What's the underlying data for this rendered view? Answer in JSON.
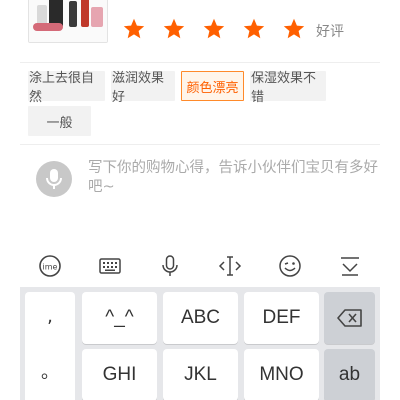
{
  "rating": {
    "stars": 5,
    "max_stars": 5,
    "label": "好评",
    "star_color": "#ff6000"
  },
  "tags": [
    {
      "label": "涂上去很自然",
      "selected": false
    },
    {
      "label": "滋润效果好",
      "selected": false
    },
    {
      "label": "颜色漂亮",
      "selected": true
    },
    {
      "label": "保湿效果不错",
      "selected": false
    },
    {
      "label": "一般",
      "selected": false
    }
  ],
  "comment": {
    "placeholder": "写下你的购物心得，告诉小伙伴们宝贝有多好吧~",
    "voice_icon": "mic-icon"
  },
  "toolbar": {
    "icons": [
      "ime-logo-icon",
      "keyboard-icon",
      "mic-icon",
      "cursor-move-icon",
      "emoji-icon",
      "collapse-keyboard-icon"
    ]
  },
  "keyboard": {
    "punct": [
      ",",
      "。"
    ],
    "row1": [
      "^_^",
      "ABC",
      "DEF"
    ],
    "row2": [
      "GHI",
      "JKL",
      "MNO"
    ],
    "delete_icon": "backspace-icon",
    "row2_func": "ab"
  }
}
